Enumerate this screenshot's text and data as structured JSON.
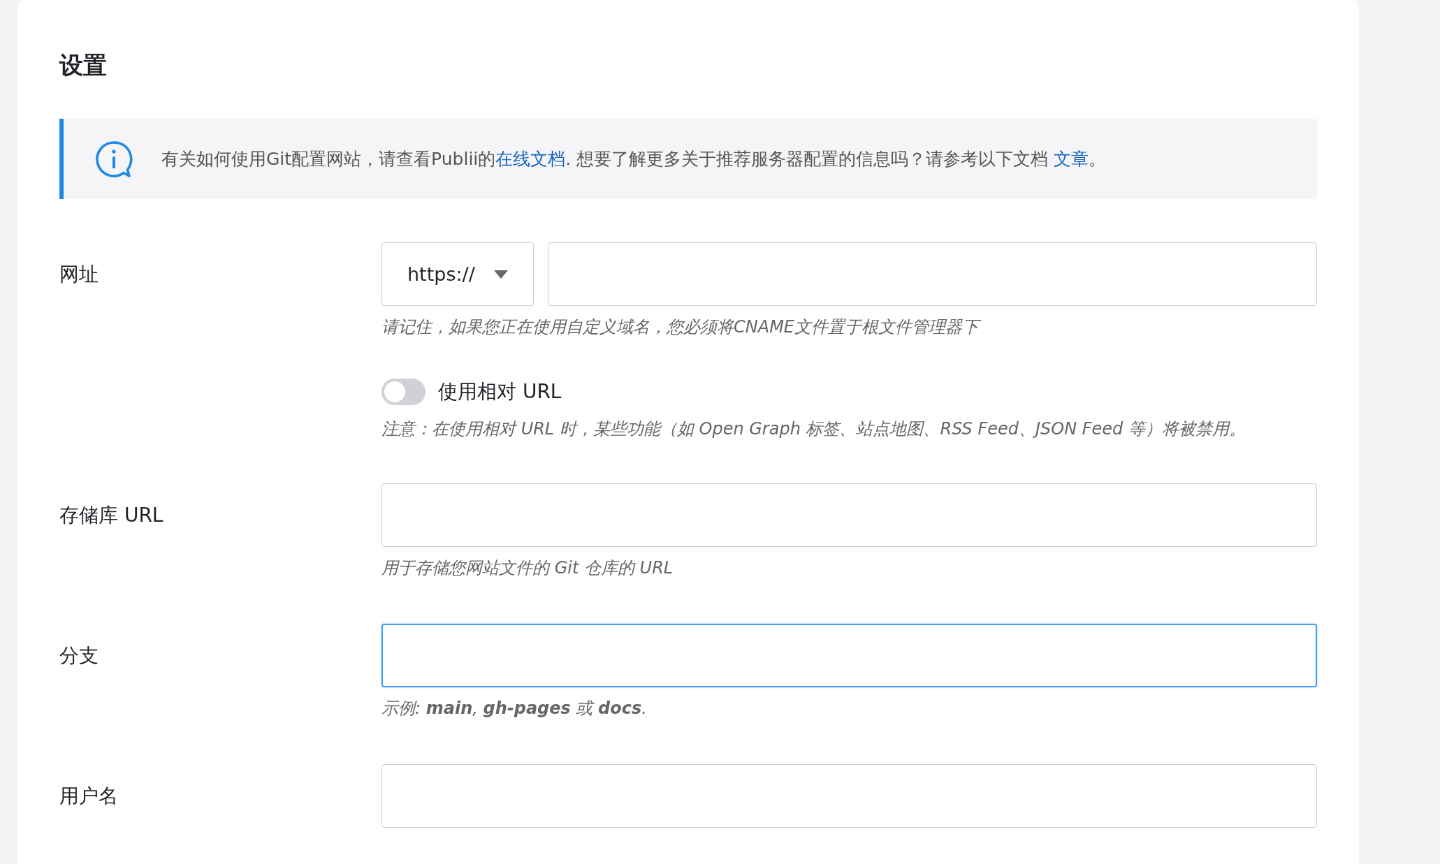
{
  "title": "设置",
  "notice": {
    "before": "有关如何使用Git配置网站，请查看Publii的",
    "link_1": "在线文档",
    "middle": ". 想要了解更多关于推荐服务器配置的信息吗？请参考以下文档 ",
    "link_2": "文章",
    "after": "。"
  },
  "fields": [
    {
      "kind": "url",
      "label": "网址",
      "protocol": "https://",
      "hint": "请记住，如果您正在使用自定义域名，您必须将CNAME文件置于根文件管理器下"
    },
    {
      "kind": "toggle",
      "label": "使用相对 URL",
      "on": false,
      "hint": "注意：在使用相对 URL 时，某些功能（如 Open Graph 标签、站点地图、RSS Feed、JSON Feed 等）将被禁用。"
    },
    {
      "kind": "text",
      "label": "存储库 URL",
      "focused": false,
      "hint": "用于存储您网站文件的 Git 仓库的 URL"
    },
    {
      "kind": "text",
      "label": "分支",
      "focused": true,
      "hint": "示例: **main**, **gh-pages** 或 **docs**."
    },
    {
      "kind": "text",
      "label": "用户名",
      "focused": false
    }
  ]
}
